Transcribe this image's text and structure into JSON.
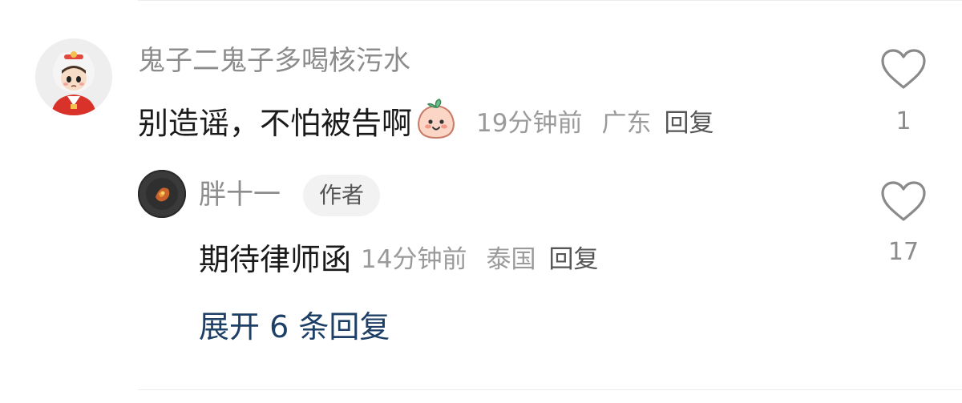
{
  "comment": {
    "username": "鬼子二鬼子多喝核污水",
    "text": "别造谣，不怕被告啊",
    "emoji": "smiling-peach-emoji",
    "time": "19分钟前",
    "location": "广东",
    "reply_label": "回复",
    "like_count": "1"
  },
  "reply": {
    "username": "胖十一",
    "badge": "作者",
    "text": "期待律师函",
    "time": "14分钟前",
    "location": "泰国",
    "reply_label": "回复",
    "like_count": "17"
  },
  "expand_label": "展开 6 条回复",
  "colors": {
    "username": "#8c8c8c",
    "text": "#1a1a1a",
    "meta": "#9a9a9a",
    "expand_link": "#1e3f66",
    "badge_bg": "#f2f2f2"
  }
}
